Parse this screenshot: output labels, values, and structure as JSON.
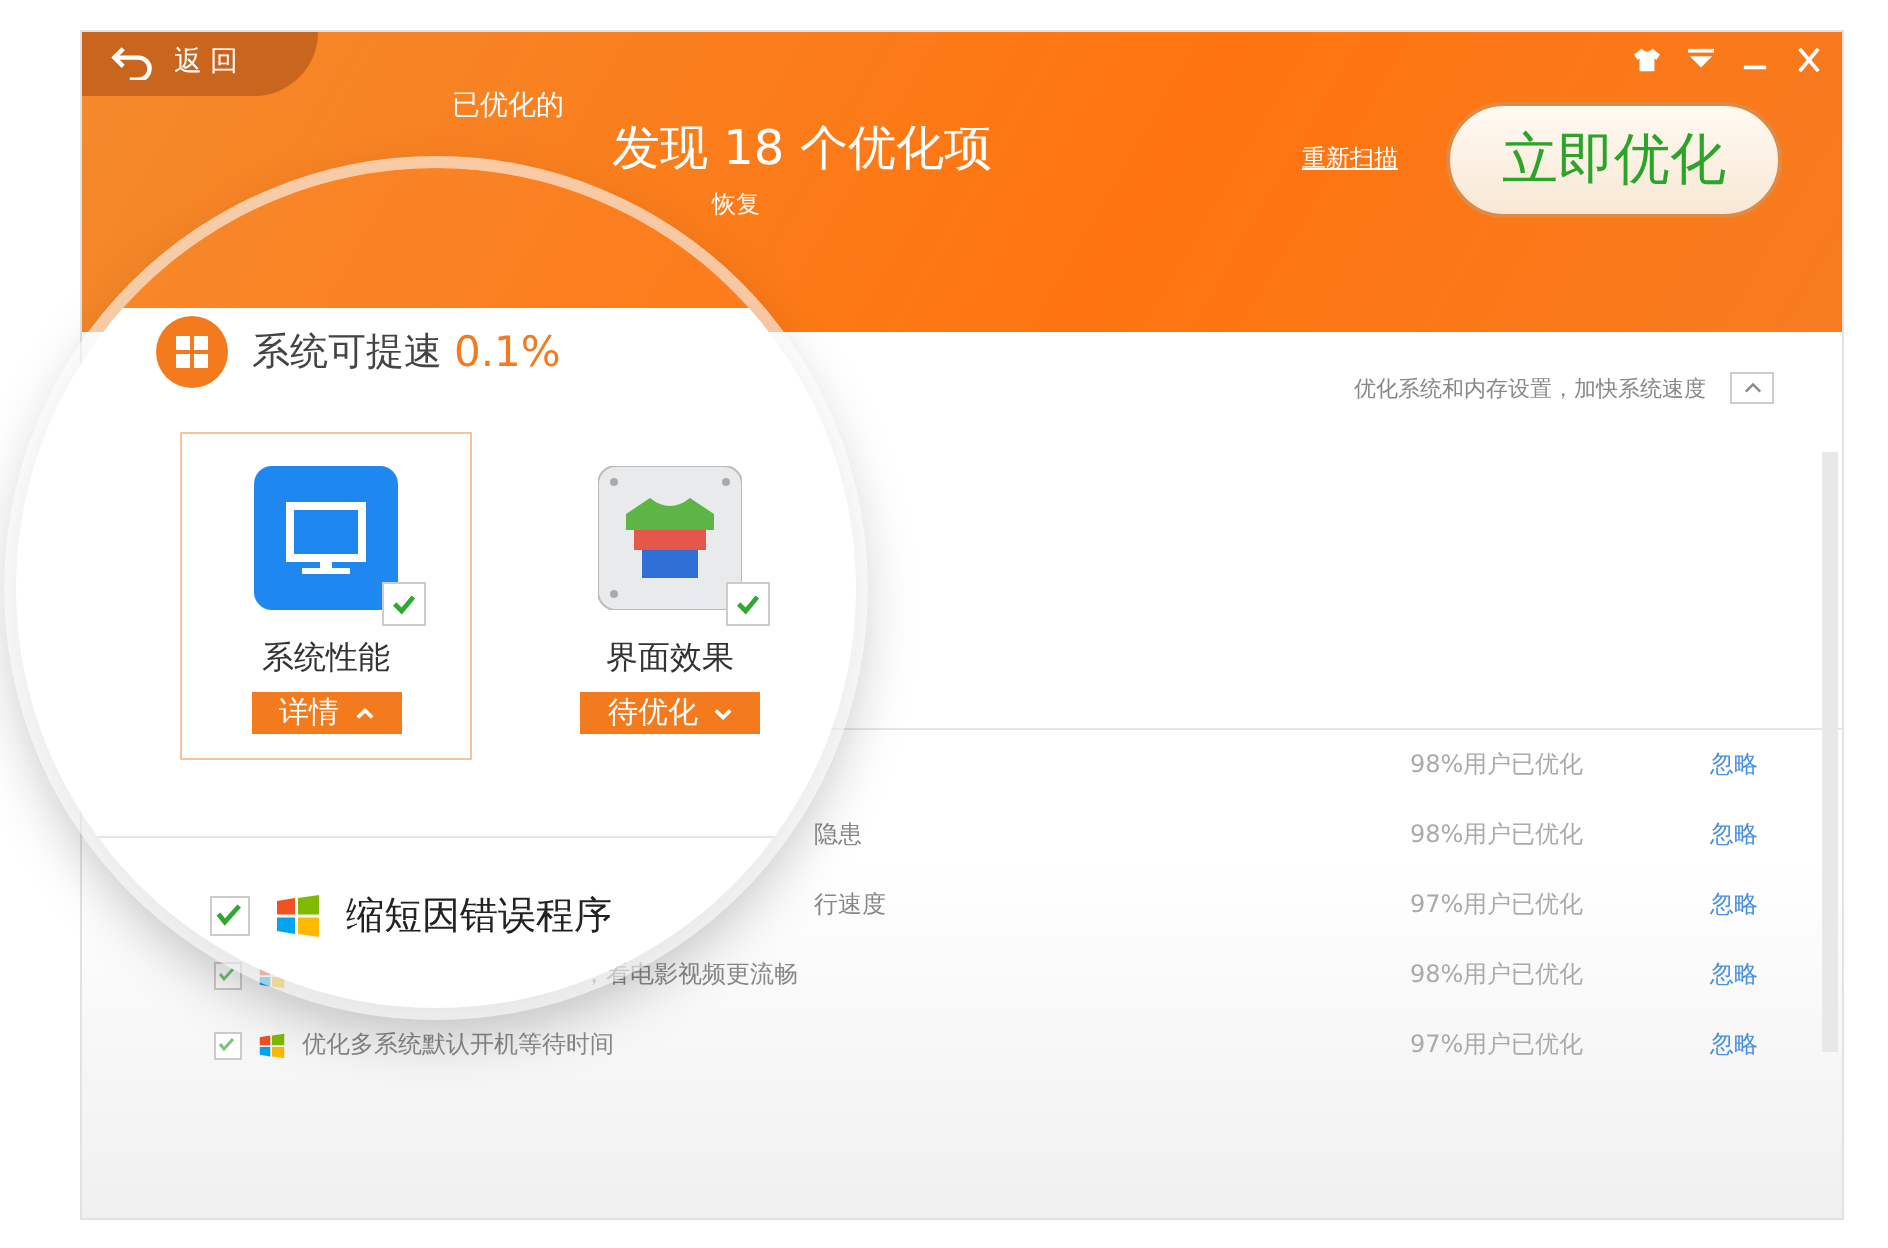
{
  "header": {
    "back": "返回",
    "done_label": "已优化的",
    "found": "发现 18 个优化项",
    "sub": "恢复",
    "rescan": "重新扫描",
    "optimize": "立即优化"
  },
  "section": {
    "description": "优化系统和内存设置，加快系统速度",
    "expanded": true
  },
  "rows": [
    {
      "kind": "covered",
      "percent": "98%用户已优化",
      "action": "忽略"
    },
    {
      "kind": "covered",
      "text": "隐患",
      "percent": "98%用户已优化",
      "action": "忽略"
    },
    {
      "kind": "covered",
      "text": "行速度",
      "percent": "97%用户已优化",
      "action": "忽略"
    },
    {
      "kind": "partial",
      "checked": true,
      "text": "，看电影视频更流畅",
      "percent": "98%用户已优化",
      "action": "忽略"
    },
    {
      "kind": "item",
      "checked": true,
      "text": "优化多系统默认开机等待时间",
      "percent": "97%用户已优化",
      "action": "忽略"
    }
  ],
  "magnifier": {
    "title": "系统可提速",
    "speedup": "0.1%",
    "categories": [
      {
        "kind": "monitor",
        "name": "系统性能",
        "checked": true,
        "selected": true,
        "button": "详情",
        "expanded": true
      },
      {
        "kind": "shirt",
        "name": "界面效果",
        "checked": true,
        "selected": false,
        "button": "待优化",
        "expanded": false
      }
    ],
    "row": {
      "checked": true,
      "text": "缩短因错误程序"
    }
  }
}
